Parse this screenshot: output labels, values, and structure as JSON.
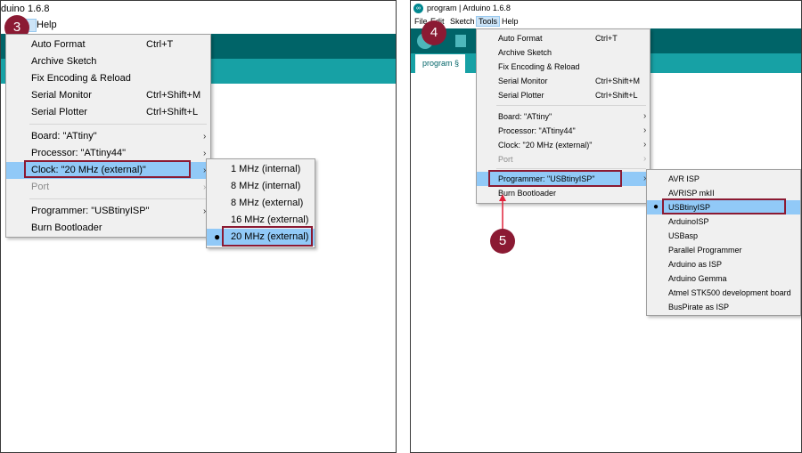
{
  "left": {
    "title_partial": "duino 1.6.8",
    "help_menu": "Help",
    "step_badge": "3",
    "tools_menu": [
      {
        "label": "Auto Format",
        "shortcut": "Ctrl+T"
      },
      {
        "label": "Archive Sketch",
        "shortcut": ""
      },
      {
        "label": "Fix Encoding & Reload",
        "shortcut": ""
      },
      {
        "label": "Serial Monitor",
        "shortcut": "Ctrl+Shift+M"
      },
      {
        "label": "Serial Plotter",
        "shortcut": "Ctrl+Shift+L"
      },
      {
        "label": "Board: \"ATtiny\"",
        "shortcut": ""
      },
      {
        "label": "Processor: \"ATtiny44\"",
        "shortcut": ""
      },
      {
        "label": "Clock: \"20 MHz (external)\"",
        "shortcut": ""
      },
      {
        "label": "Port",
        "shortcut": ""
      },
      {
        "label": "Programmer: \"USBtinyISP\"",
        "shortcut": ""
      },
      {
        "label": "Burn Bootloader",
        "shortcut": ""
      }
    ],
    "clock_submenu": [
      "1 MHz (internal)",
      "8 MHz (internal)",
      "8 MHz (external)",
      "16 MHz (external)",
      "20 MHz (external)"
    ]
  },
  "right": {
    "title": "program | Arduino 1.6.8",
    "menubar": [
      "File",
      "Edit",
      "Sketch",
      "Tools",
      "Help"
    ],
    "tab_label": "program §",
    "step_badge_4": "4",
    "step_badge_5": "5",
    "tools_menu": [
      {
        "label": "Auto Format",
        "shortcut": "Ctrl+T"
      },
      {
        "label": "Archive Sketch",
        "shortcut": ""
      },
      {
        "label": "Fix Encoding & Reload",
        "shortcut": ""
      },
      {
        "label": "Serial Monitor",
        "shortcut": "Ctrl+Shift+M"
      },
      {
        "label": "Serial Plotter",
        "shortcut": "Ctrl+Shift+L"
      },
      {
        "label": "Board: \"ATtiny\"",
        "shortcut": ""
      },
      {
        "label": "Processor: \"ATtiny44\"",
        "shortcut": ""
      },
      {
        "label": "Clock: \"20 MHz (external)\"",
        "shortcut": ""
      },
      {
        "label": "Port",
        "shortcut": ""
      },
      {
        "label": "Programmer: \"USBtinyISP\"",
        "shortcut": ""
      },
      {
        "label": "Burn Bootloader",
        "shortcut": ""
      }
    ],
    "programmer_submenu": [
      "AVR ISP",
      "AVRISP mkII",
      "USBtinyISP",
      "ArduinoISP",
      "USBasp",
      "Parallel Programmer",
      "Arduino as ISP",
      "Arduino Gemma",
      "Atmel STK500 development board",
      "BusPirate as ISP"
    ]
  },
  "colors": {
    "toolbar_dark_teal": "#006468",
    "tab_teal": "#17a1a5",
    "highlight": "#91c9f7",
    "annotation": "#8b1a33"
  }
}
